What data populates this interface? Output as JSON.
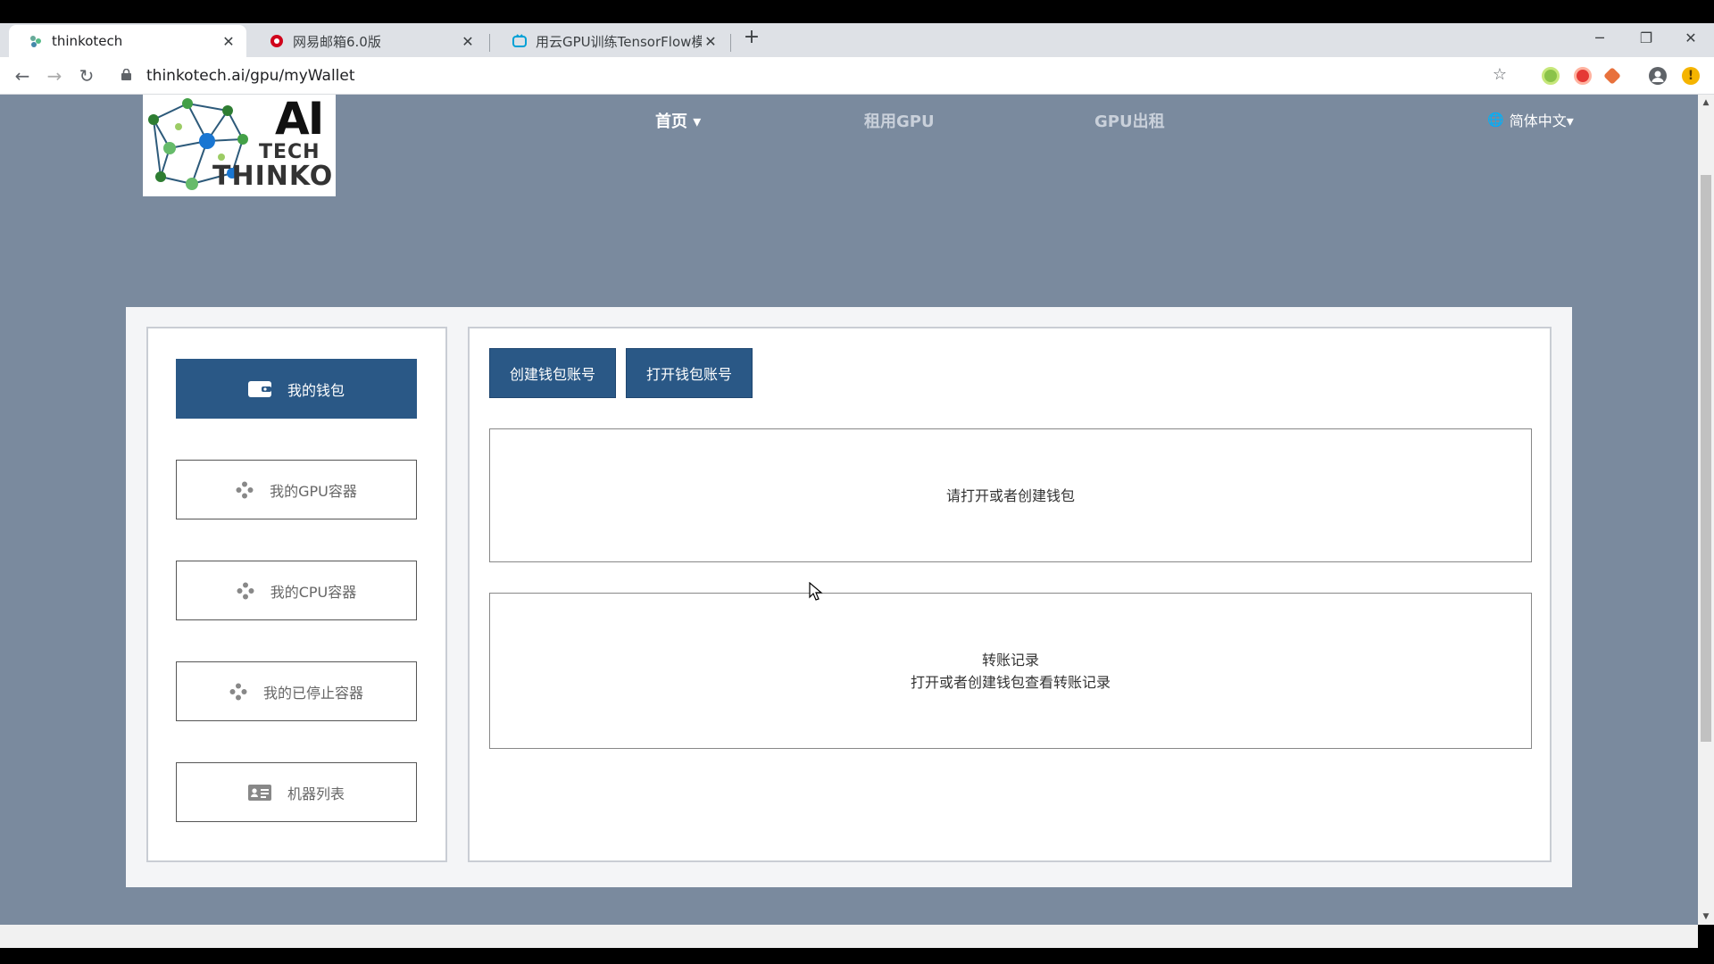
{
  "browser": {
    "tabs": [
      {
        "title": "thinkotech",
        "active": true
      },
      {
        "title": "网易邮箱6.0版",
        "active": false
      },
      {
        "title": "用云GPU训练TensorFlow模型",
        "active": false
      }
    ],
    "url": "thinkotech.ai/gpu/myWallet"
  },
  "header": {
    "logo": {
      "ai": "AI",
      "tech": "TECH",
      "thinko": "THINKO"
    },
    "nav": [
      {
        "label": "首页 ▾",
        "active": true
      },
      {
        "label": "租用GPU",
        "active": false
      },
      {
        "label": "GPU出租",
        "active": false
      }
    ],
    "language": "简体中文▾"
  },
  "sidebar": {
    "items": [
      {
        "label": "我的钱包",
        "icon": "wallet-icon",
        "active": true
      },
      {
        "label": "我的GPU容器",
        "icon": "cluster-icon",
        "active": false
      },
      {
        "label": "我的CPU容器",
        "icon": "cluster-icon",
        "active": false
      },
      {
        "label": "我的已停止容器",
        "icon": "cluster-icon",
        "active": false
      },
      {
        "label": "机器列表",
        "icon": "id-card-icon",
        "active": false
      }
    ]
  },
  "main": {
    "create_wallet_label": "创建钱包账号",
    "open_wallet_label": "打开钱包账号",
    "wallet_prompt": "请打开或者创建钱包",
    "transfer_title": "转账记录",
    "transfer_hint": "打开或者创建钱包查看转账记录"
  },
  "colors": {
    "page_bg": "#7a8a9e",
    "primary": "#2a5886"
  }
}
